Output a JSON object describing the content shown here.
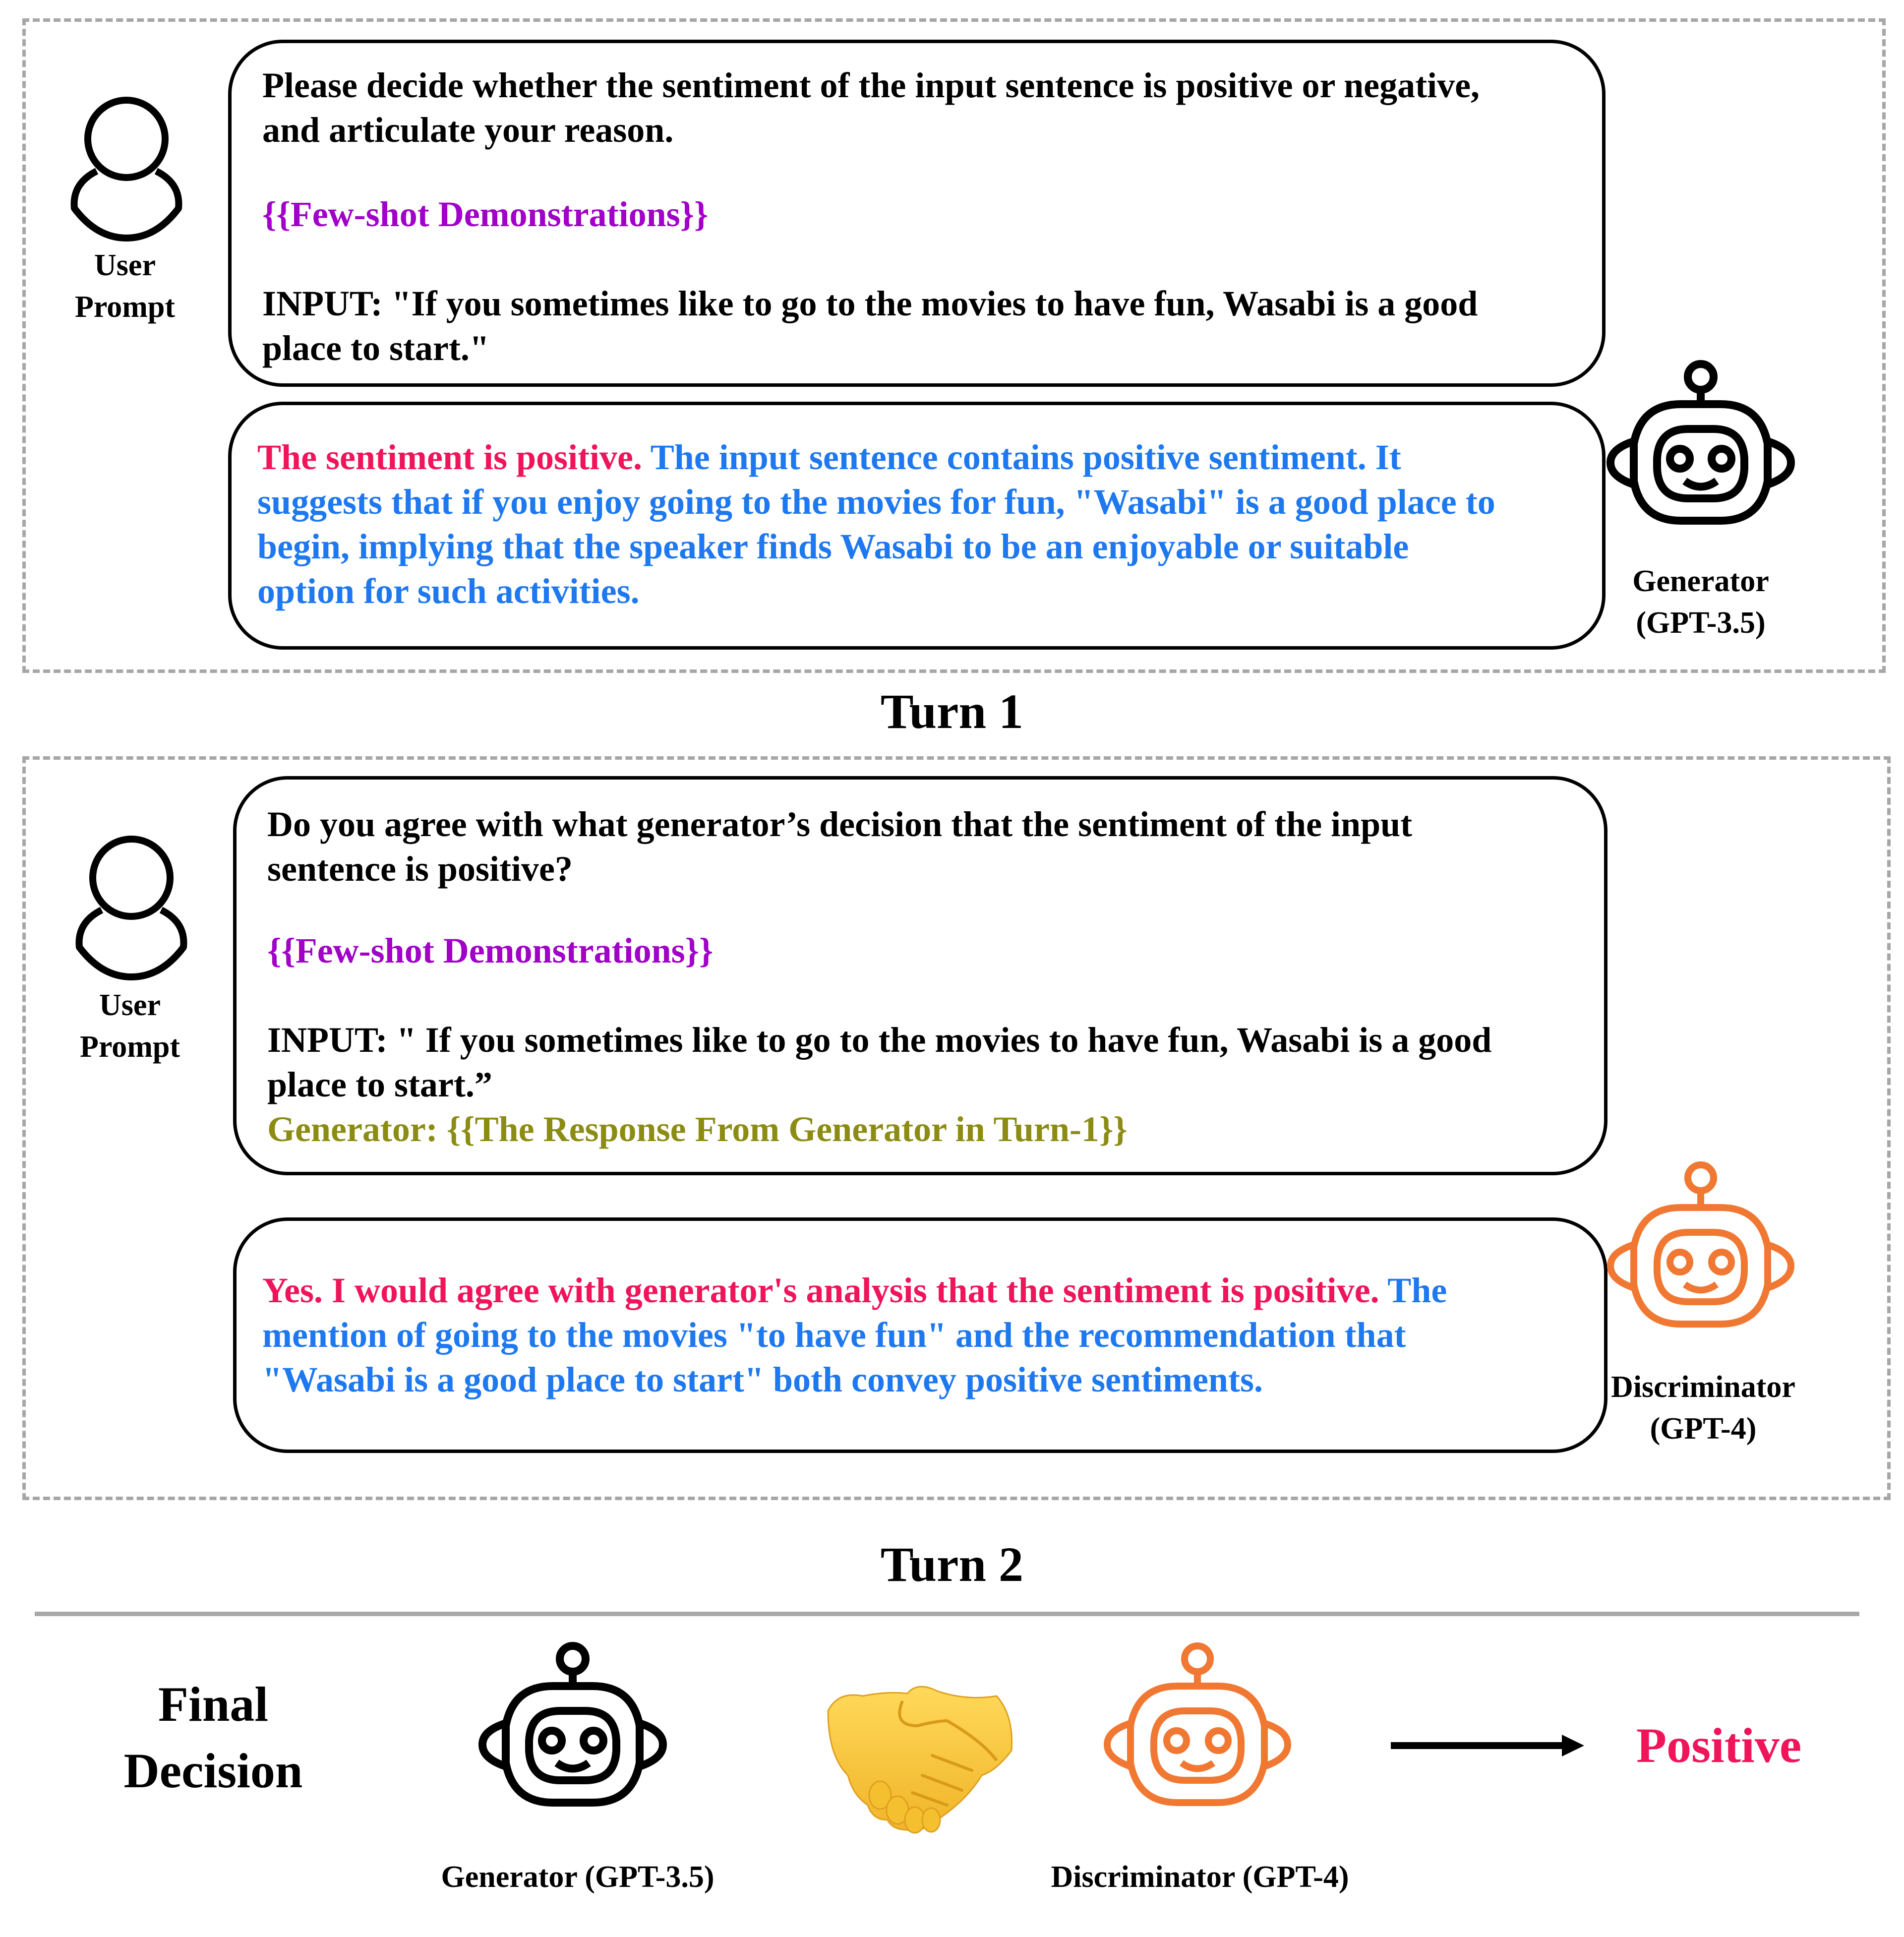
{
  "colors": {
    "instruction": "#000000",
    "placeholder_demo": "#a000c8",
    "placeholder_generator": "#8c8c14",
    "verdict": "#f0145a",
    "explanation": "#1e78f0",
    "generator_icon": "#000000",
    "discriminator_icon": "#f07832",
    "frame_dash": "#a6a6a6",
    "final_result": "#f0145a"
  },
  "turn1": {
    "title": "Turn 1",
    "user_label_line1": "User",
    "user_label_line2": "Prompt",
    "prompt": {
      "instruction": "Please decide whether the sentiment of the input sentence is positive or negative,\nand articulate your reason.",
      "demonstrations": "{{Few-shot Demonstrations}}",
      "input": "INPUT: \"If you sometimes like to go to the movies to have fun, Wasabi is a good\nplace to start.\""
    },
    "response": {
      "verdict": "The sentiment is positive.",
      "explanation": " The input sentence contains positive sentiment. It\nsuggests that if you enjoy going to the movies for fun, \"Wasabi\" is a good place to\nbegin, implying that the speaker finds Wasabi to be an enjoyable or suitable\noption for such activities."
    },
    "agent_label_line1": "Generator",
    "agent_label_line2": "(GPT-3.5)"
  },
  "turn2": {
    "title": "Turn 2",
    "user_label_line1": "User",
    "user_label_line2": "Prompt",
    "prompt": {
      "instruction": "Do you agree with what generator’s decision that the sentiment of the input\nsentence is positive?",
      "demonstrations": "{{Few-shot Demonstrations}}",
      "input": "INPUT: \" If you sometimes like to go to the movies to have fun, Wasabi is a good\nplace to start.”",
      "generator_ref": "Generator: {{The Response From Generator in Turn-1}}"
    },
    "response": {
      "verdict": "Yes. I would agree with generator's analysis that the sentiment is positive.",
      "explanation": " The\nmention of going to the movies \"to have fun\" and the recommendation that\n\"Wasabi is a good place to start\" both convey positive sentiments."
    },
    "agent_label_line1": "Discriminator",
    "agent_label_line2": "(GPT-4)"
  },
  "final": {
    "title_line1": "Final",
    "title_line2": "Decision",
    "generator_label": "Generator (GPT-3.5)",
    "discriminator_label": "Discriminator (GPT-4)",
    "agreement_icon": "handshake-icon",
    "result": "Positive"
  }
}
